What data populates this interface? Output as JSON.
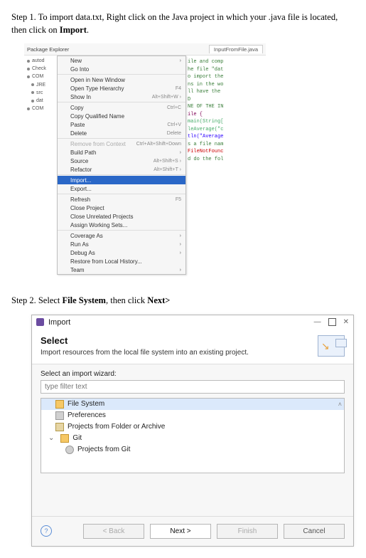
{
  "step1": {
    "text_pre": "Step 1. To import data.txt, Right click on the Java project in which your .java file is located, then click on ",
    "text_bold": "Import",
    "text_post": "."
  },
  "eclipse": {
    "view_title": "Package Explorer",
    "editor_tab": "InputFromFile.java",
    "tree": [
      "autod",
      "Check",
      "COM",
      "JRE",
      "src",
      "dat",
      "COM"
    ],
    "menu": {
      "new": "New",
      "go_into": "Go Into",
      "open_new_window": "Open in New Window",
      "open_type_hierarchy": {
        "label": "Open Type Hierarchy",
        "shortcut": "F4"
      },
      "show_in": {
        "label": "Show In",
        "shortcut": "Alt+Shift+W ›"
      },
      "copy": {
        "label": "Copy",
        "shortcut": "Ctrl+C"
      },
      "copy_qualified_name": "Copy Qualified Name",
      "paste": {
        "label": "Paste",
        "shortcut": "Ctrl+V"
      },
      "delete": {
        "label": "Delete",
        "shortcut": "Delete"
      },
      "remove_context": {
        "label": "Remove from Context",
        "shortcut": "Ctrl+Alt+Shift+Down"
      },
      "build_path": "Build Path",
      "source": {
        "label": "Source",
        "shortcut": "Alt+Shift+S ›"
      },
      "refactor": {
        "label": "Refactor",
        "shortcut": "Alt+Shift+T ›"
      },
      "import": "Import...",
      "export": "Export...",
      "refresh": {
        "label": "Refresh",
        "shortcut": "F5"
      },
      "close_project": "Close Project",
      "close_unrelated": "Close Unrelated Projects",
      "assign_ws": "Assign Working Sets...",
      "coverage_as": "Coverage As",
      "run_as": "Run As",
      "debug_as": "Debug As",
      "restore_local": "Restore from Local History...",
      "team": "Team"
    },
    "code_snips": [
      "ile and comp",
      "he file \"dat",
      "o import the",
      "ns in the wo",
      "ll have the",
      "D",
      "NE OF THE IN",
      "",
      "ile {",
      "",
      "main(String[",
      "",
      "leAverage(\"c",
      "tln(\"Average",
      "",
      "s a file nam",
      "FileNotFounc",
      "",
      "d do the fol"
    ]
  },
  "step2": {
    "text_pre": "Step 2. Select ",
    "bold1": "File System",
    "mid": ", then click ",
    "bold2": "Next>"
  },
  "dialog": {
    "title": "Import",
    "heading": "Select",
    "description": "Import resources from the local file system into an existing project.",
    "wizard_label": "Select an import wizard:",
    "filter_placeholder": "type filter text",
    "items": {
      "file_system": "File System",
      "preferences": "Preferences",
      "projects_archive": "Projects from Folder or Archive",
      "git_group": "Git",
      "projects_git": "Projects from Git"
    },
    "buttons": {
      "back": "< Back",
      "next": "Next >",
      "finish": "Finish",
      "cancel": "Cancel"
    }
  }
}
